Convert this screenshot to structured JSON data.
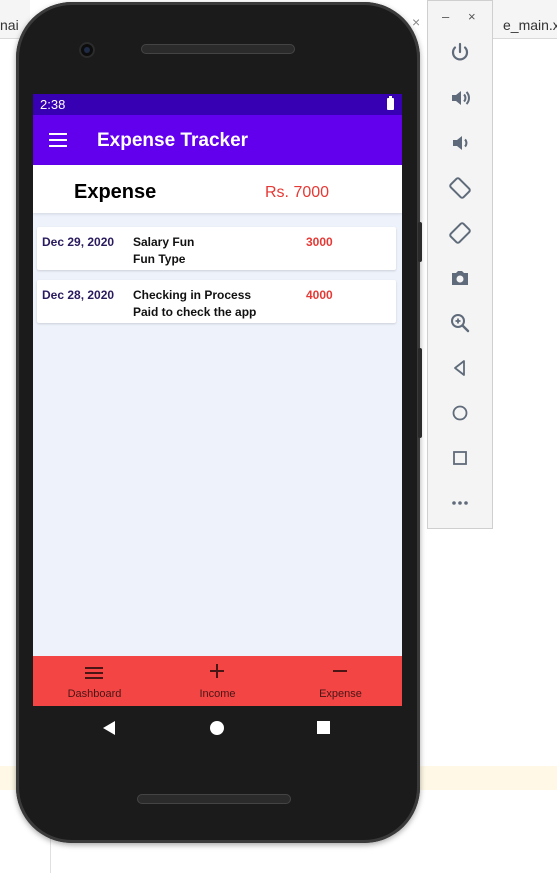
{
  "ide": {
    "left_tab_fragment": "nai",
    "right_tab_fragment": "e_main.xn"
  },
  "status_bar": {
    "time": "2:38"
  },
  "app_bar": {
    "title": "Expense Tracker"
  },
  "summary": {
    "label": "Expense",
    "amount": "Rs. 7000"
  },
  "transactions": [
    {
      "date": "Dec 29, 2020",
      "title": "Salary Fun",
      "subtitle": "Fun Type",
      "amount": "3000"
    },
    {
      "date": "Dec 28, 2020",
      "title": "Checking in Process",
      "subtitle": "Paid to check the app",
      "amount": "4000"
    }
  ],
  "bottom_nav": {
    "items": [
      {
        "label": "Dashboard",
        "icon": "menu-icon"
      },
      {
        "label": "Income",
        "icon": "plus-icon"
      },
      {
        "label": "Expense",
        "icon": "minus-icon"
      }
    ]
  },
  "emulator_toolbar": {
    "minimize": "–",
    "close": "×",
    "buttons": [
      "power-icon",
      "volume-up-icon",
      "volume-down-icon",
      "rotate-left-icon",
      "rotate-right-icon",
      "camera-icon",
      "zoom-icon",
      "back-icon",
      "home-icon",
      "overview-icon",
      "more-icon"
    ]
  },
  "colors": {
    "status_bar": "#3700b3",
    "app_bar": "#6200ee",
    "bottom_nav": "#f44545",
    "amount": "#e53935",
    "screen_bg": "#eef2fb"
  }
}
